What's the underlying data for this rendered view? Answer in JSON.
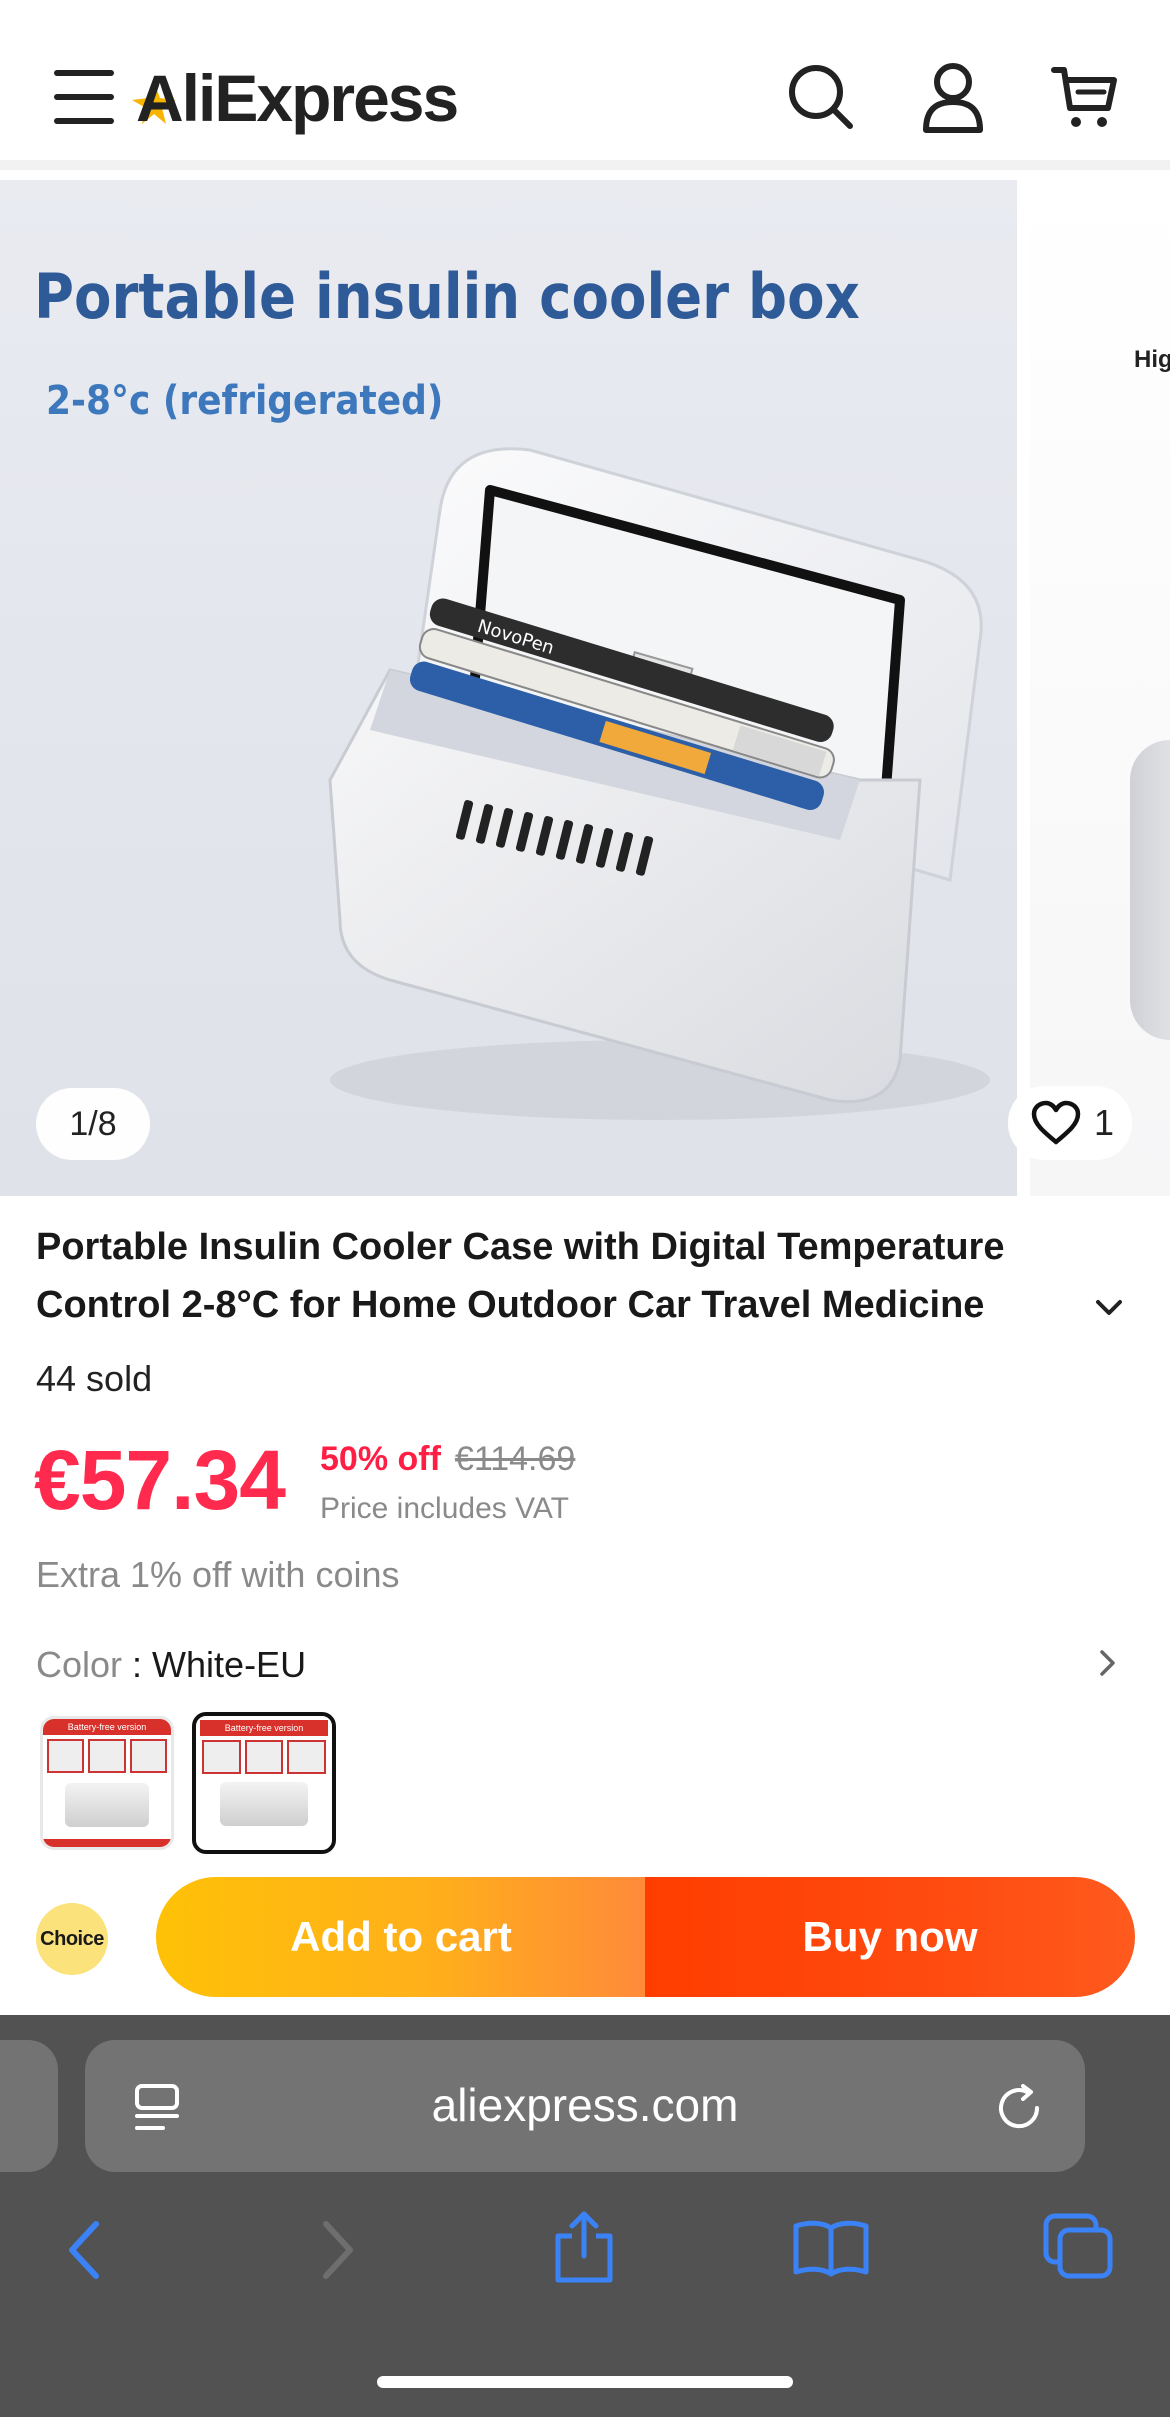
{
  "header": {
    "logo": "AliExpress",
    "icons": [
      "menu-icon",
      "search-icon",
      "account-icon",
      "cart-icon"
    ]
  },
  "gallery": {
    "slide_heading": "Portable insulin cooler box",
    "slide_subheading": "2-8°c (refrigerated)",
    "pen_brand": "NovoPen",
    "counter": "1/8",
    "wishlist_count": "1",
    "next_slide_text": "High"
  },
  "product": {
    "title_line1": "Portable Insulin Cooler Case with Digital Temperature",
    "title_line2": "Control 2-8°C for Home Outdoor Car Travel Medicine",
    "sold": "44 sold",
    "price": "€57.34",
    "discount": "50% off",
    "original_price": "€114.69",
    "vat_note": "Price includes VAT",
    "coins_note": "Extra 1% off with coins",
    "color_label": "Color",
    "color_separator": " : ",
    "color_value": "White-EU",
    "swatch_banner": "Battery-free version"
  },
  "actions": {
    "choice_badge": "Choice",
    "add_to_cart": "Add to cart",
    "buy_now": "Buy now"
  },
  "browser": {
    "url": "aliexpress.com"
  },
  "colors": {
    "price": "#ff2a4d",
    "cart_start": "#ffc107",
    "buy_start": "#ff3d00",
    "slide_title": "#2e5a98",
    "browser_bg": "#525252",
    "toolbar_icon": "#3b82f6"
  }
}
